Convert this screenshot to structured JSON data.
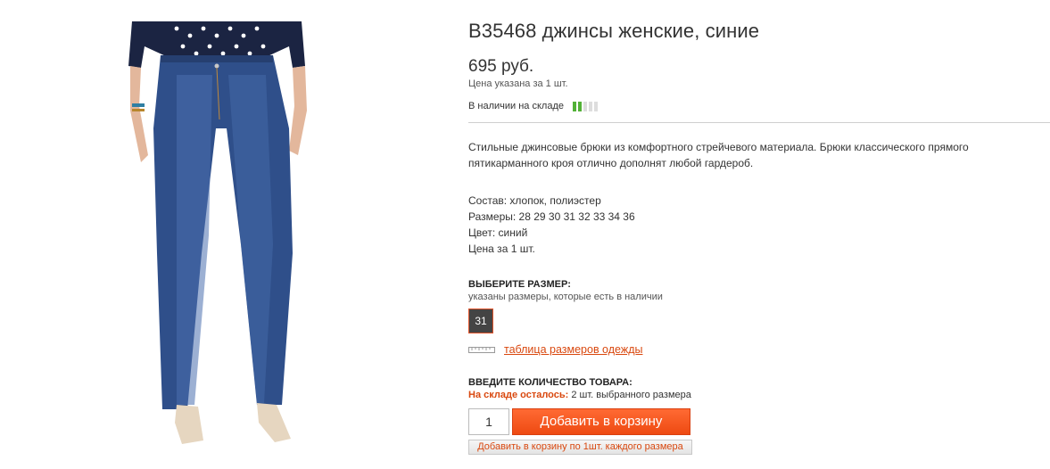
{
  "product": {
    "title": "B35468 джинсы женские, синие",
    "price": "695 руб.",
    "price_note": "Цена указана за 1 шт.",
    "stock_label": "В наличии на складе",
    "stock_level": 0.4,
    "description": "Стильные джинсовые брюки из комфортного стрейчевого материала. Брюки классического прямого пятикарманного кроя отлично дополнят любой гардероб.",
    "props": {
      "composition": "Состав:  хлопок, полиэстер",
      "sizes": "Размеры: 28 29 30 31 32 33 34 36",
      "color": "Цвет: синий",
      "price_per": "Цена за 1 шт."
    }
  },
  "size_select": {
    "heading": "ВЫБЕРИТЕ РАЗМЕР:",
    "note": "указаны размеры, которые есть в наличии",
    "options": [
      "31"
    ],
    "chart_link": "таблица размеров одежды"
  },
  "quantity": {
    "heading": "ВВЕДИТЕ КОЛИЧЕСТВО ТОВАРА:",
    "left_label": "На складе осталось:",
    "left_text": "2 шт. выбранного размера",
    "value": "1",
    "add_button": "Добавить в корзину",
    "add_all_button": "Добавить в корзину по 1шт. каждого размера"
  },
  "colors": {
    "accent": "#ee4a12",
    "link": "#d9480f",
    "stock_green": "#52b137",
    "denim": "#2f4f8a"
  }
}
